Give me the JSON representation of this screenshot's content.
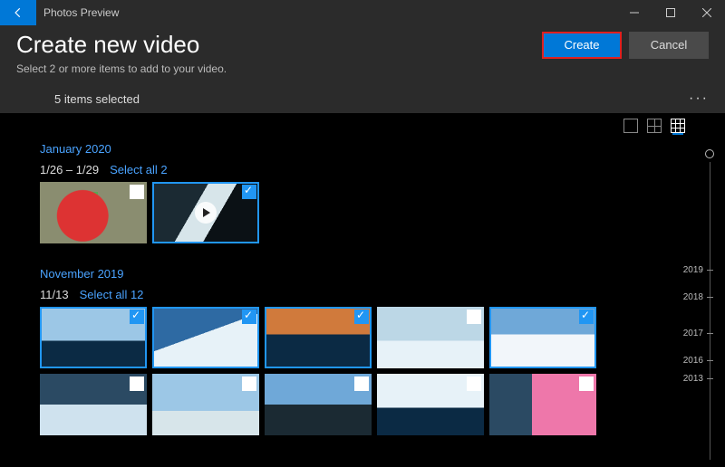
{
  "titlebar": {
    "app_name": "Photos Preview"
  },
  "header": {
    "title": "Create new video",
    "subtitle": "Select 2 or more items to add to your video.",
    "create_label": "Create",
    "cancel_label": "Cancel"
  },
  "status": {
    "selected_text": "5 items selected"
  },
  "groups": [
    {
      "title": "January 2020",
      "date_range": "1/26 – 1/29",
      "select_all": "Select all 2",
      "items": [
        {
          "selected": false,
          "is_video": false,
          "art": "apple"
        },
        {
          "selected": true,
          "is_video": true,
          "art": "waterfall"
        }
      ]
    },
    {
      "title": "November 2019",
      "date_range": "11/13",
      "select_all": "Select all 12",
      "items": [
        {
          "selected": true,
          "art": "ice1"
        },
        {
          "selected": true,
          "art": "ice2"
        },
        {
          "selected": true,
          "art": "ice3"
        },
        {
          "selected": false,
          "art": "ice4"
        },
        {
          "selected": true,
          "art": "ice5"
        },
        {
          "selected": false,
          "art": "ice6"
        },
        {
          "selected": false,
          "art": "ice7"
        },
        {
          "selected": false,
          "art": "ice8"
        },
        {
          "selected": false,
          "art": "ice9"
        },
        {
          "selected": false,
          "art": "ice10"
        }
      ]
    }
  ],
  "timeline": {
    "years": [
      "2019",
      "2018",
      "2017",
      "2016",
      "2013"
    ]
  }
}
